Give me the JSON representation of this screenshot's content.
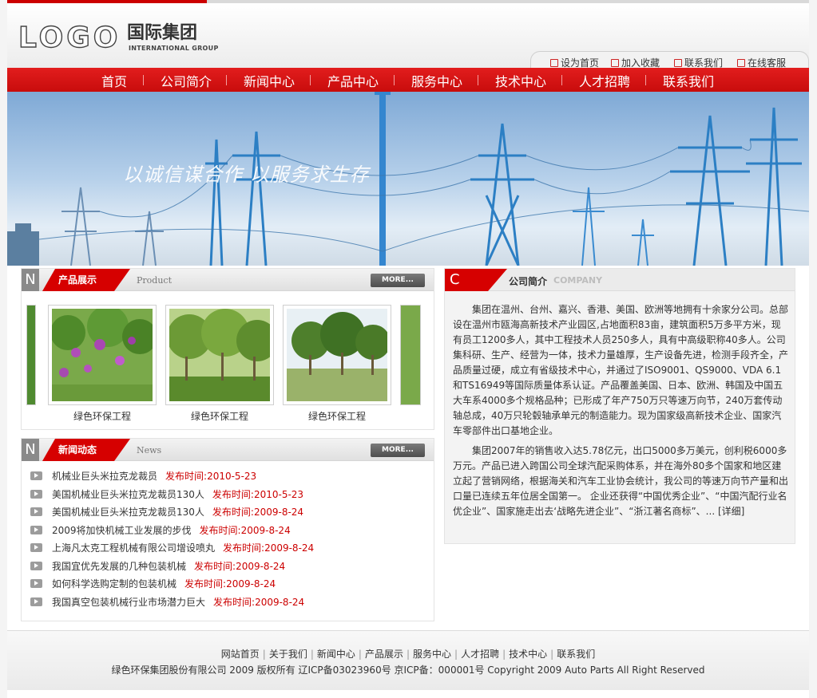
{
  "logo": {
    "word": "LOGO",
    "cn": "国际集团",
    "en": "INTERNATIONAL GROUP"
  },
  "quick_links": [
    {
      "label": "设为首页",
      "icon": "home-icon"
    },
    {
      "label": "加入收藏",
      "icon": "favorite-icon"
    },
    {
      "label": "联系我们",
      "icon": "mail-icon"
    },
    {
      "label": "在线客服",
      "icon": "service-icon"
    }
  ],
  "nav": [
    "首页",
    "公司简介",
    "新闻中心",
    "产品中心",
    "服务中心",
    "技术中心",
    "人才招聘",
    "联系我们"
  ],
  "banner": {
    "slogan": "以诚信谋合作 以服务求生存"
  },
  "products": {
    "letter": "N",
    "title": "产品展示",
    "en": "Product",
    "more": "MORE...",
    "items": [
      {
        "name": "绿色环保工程"
      },
      {
        "name": "绿色环保工程"
      },
      {
        "name": "绿色环保工程"
      }
    ]
  },
  "news": {
    "letter": "N",
    "title": "新闻动态",
    "en": "News",
    "more": "MORE...",
    "date_prefix": "发布时间:",
    "items": [
      {
        "title": "机械业巨头米拉克龙裁员",
        "date": "2010-5-23"
      },
      {
        "title": "美国机械业巨头米拉克龙裁员130人",
        "date": "2010-5-23"
      },
      {
        "title": "美国机械业巨头米拉克龙裁员130人",
        "date": "2009-8-24"
      },
      {
        "title": "2009将加快机械工业发展的步伐",
        "date": "2009-8-24"
      },
      {
        "title": "上海凡太克工程机械有限公司增设喷丸",
        "date": "2009-8-24"
      },
      {
        "title": "我国宜优先发展的几种包装机械",
        "date": "2009-8-24"
      },
      {
        "title": "如何科学选购定制的包装机械",
        "date": "2009-8-24"
      },
      {
        "title": "我国真空包装机械行业市场潜力巨大",
        "date": "2009-8-24"
      }
    ]
  },
  "about": {
    "letter": "C",
    "title": "公司简介",
    "en": "COMPANY",
    "p1": "集团在温州、台州、嘉兴、香港、美国、欧洲等地拥有十余家分公司。总部设在温州市瓯海高新技术产业园区,占地面积83亩，建筑面积5万多平方米，现有员工1200多人，其中工程技术人员250多人，具有中高级职称40多人。公司集科研、生产、经营为一体，技术力量雄厚，生产设备先进，检测手段齐全，产品质量过硬，成立有省级技术中心，并通过了ISO9001、QS9000、VDA 6.1和TS16949等国际质量体系认证。产品覆盖美国、日本、欧洲、韩国及中国五大车系4000多个规格品种；已形成了年产750万只等速万向节，240万套传动轴总成，40万只轮毂轴承单元的制造能力。现为国家级高新技术企业、国家汽车零部件出口基地企业。",
    "p2": "集团2007年的销售收入达5.78亿元，出口5000多万美元，创利税6000多万元。产品已进入跨国公司全球汽配采购体系，并在海外80多个国家和地区建立起了营销网络，根据海关和汽车工业协会统计，我公司的等速万向节产量和出口量已连续五年位居全国第一。 企业还获得“中国优秀企业”、“中国汽配行业名优企业”、国家施走出去‘战略先进企业”、“浙江著名商标”、... [详细]"
  },
  "footer": {
    "links": [
      "网站首页",
      "关于我们",
      "新闻中心",
      "产品展示",
      "服务中心",
      "人才招聘",
      "技术中心",
      "联系我们"
    ],
    "copyright": "绿色环保集团股份有限公司 2009 版权所有 辽ICP备03023960号 京ICP备：000001号 Copyright 2009 Auto Parts All Right Reserved"
  }
}
